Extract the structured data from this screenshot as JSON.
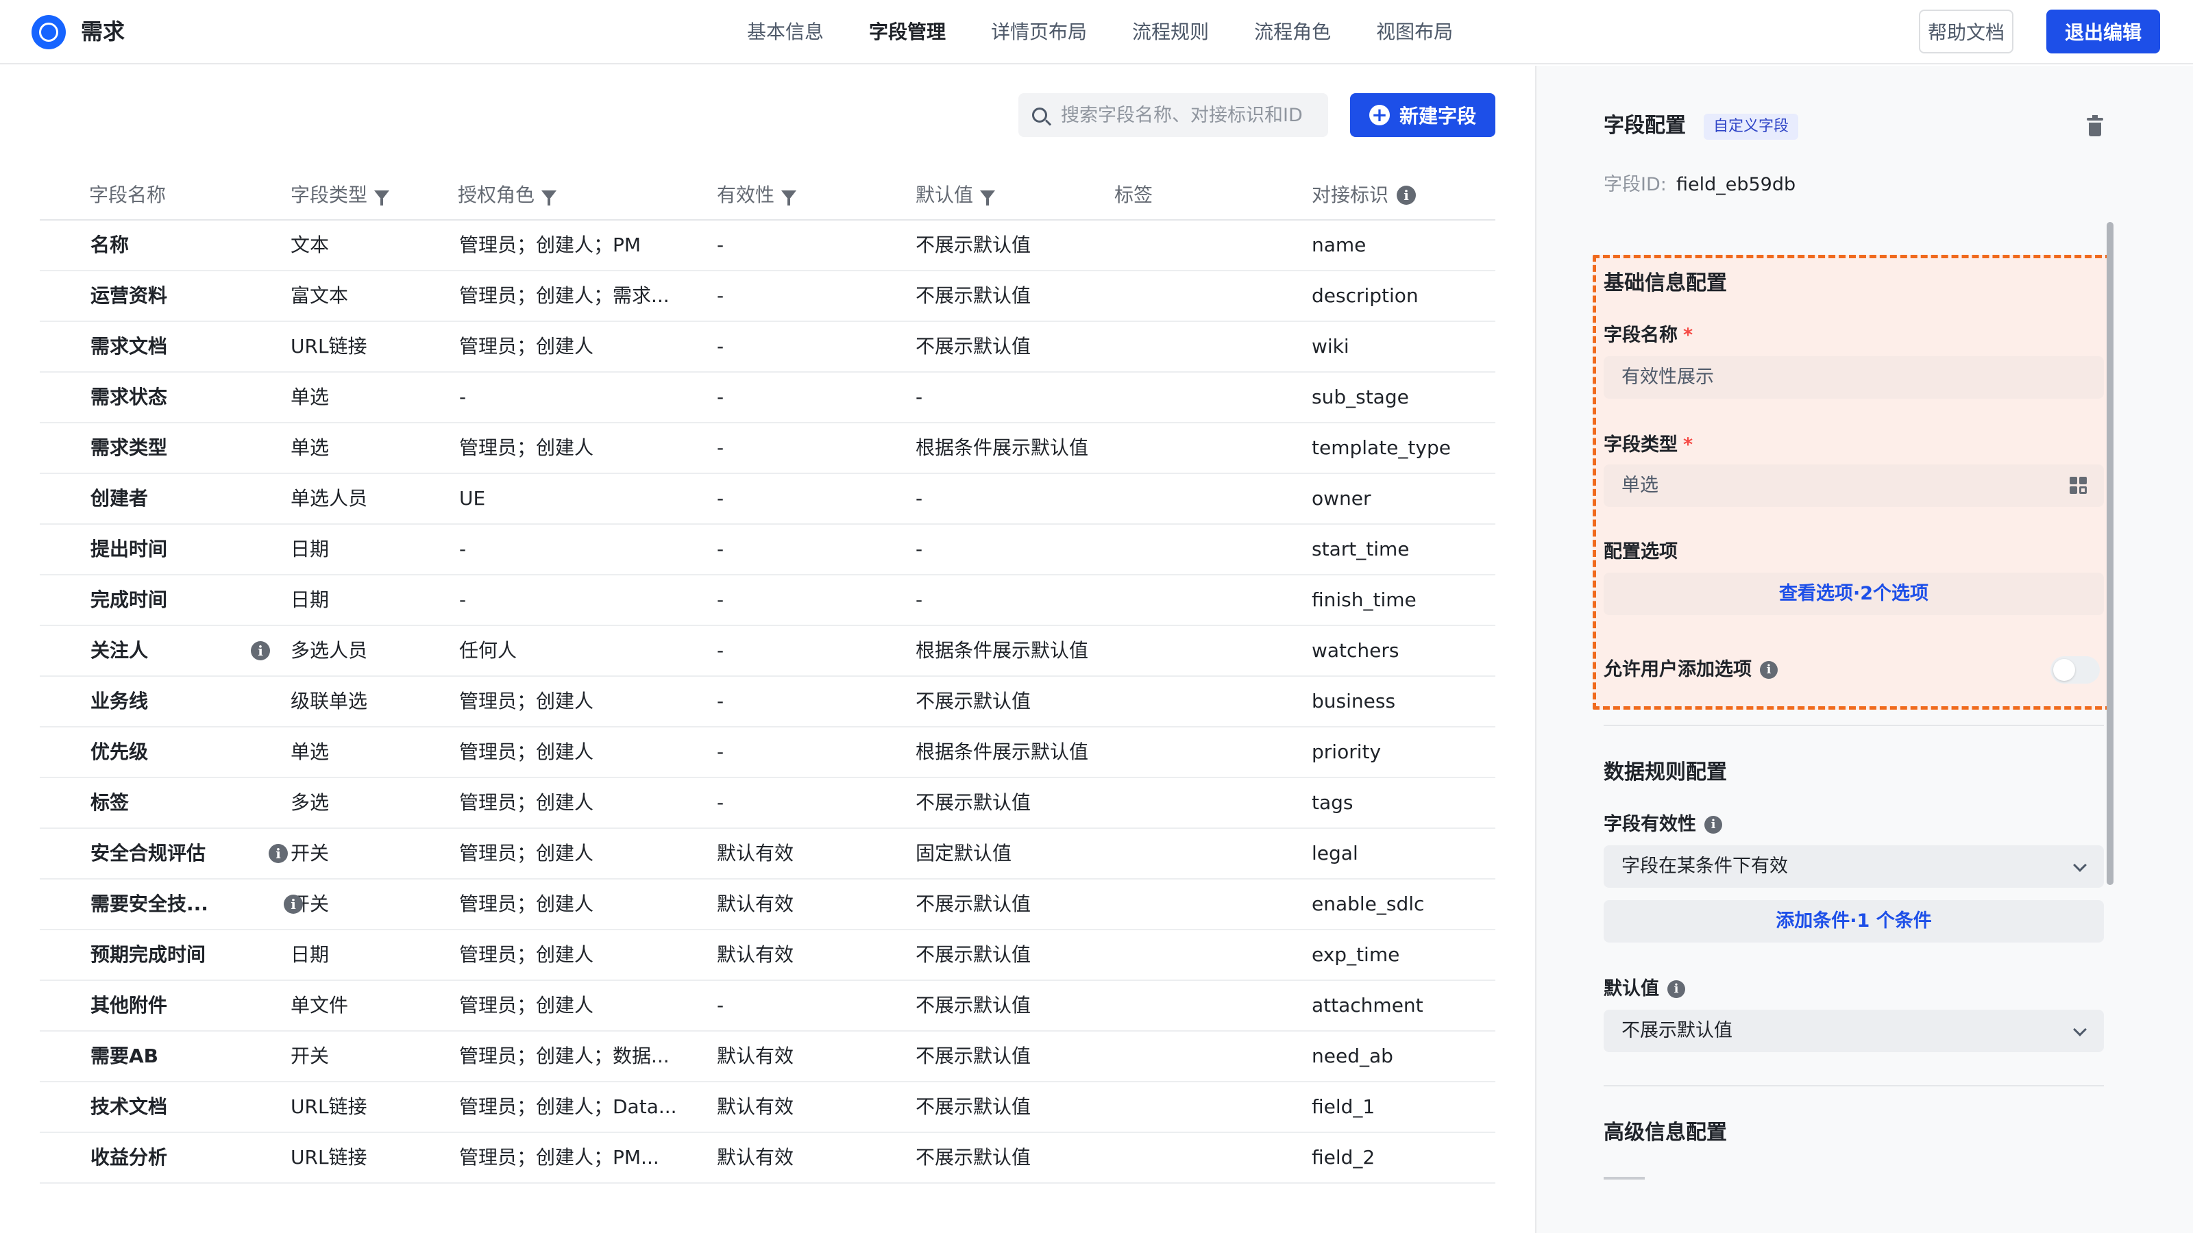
{
  "app": {
    "title": "需求"
  },
  "nav": [
    {
      "label": "基本信息",
      "active": false
    },
    {
      "label": "字段管理",
      "active": true
    },
    {
      "label": "详情页布局",
      "active": false
    },
    {
      "label": "流程规则",
      "active": false
    },
    {
      "label": "流程角色",
      "active": false
    },
    {
      "label": "视图布局",
      "active": false
    }
  ],
  "header_actions": {
    "help": "帮助文档",
    "exit": "退出编辑"
  },
  "toolbar": {
    "search_placeholder": "搜索字段名称、对接标识和ID",
    "new_field": "新建字段"
  },
  "table": {
    "columns": [
      "字段名称",
      "字段类型",
      "授权角色",
      "有效性",
      "默认值",
      "标签",
      "对接标识"
    ],
    "rows": [
      {
        "name": "名称",
        "type": "文本",
        "roles": "管理员；创建人；PM",
        "validity": "-",
        "default": "不展示默认值",
        "tag": "",
        "key": "name",
        "info": false
      },
      {
        "name": "运营资料",
        "type": "富文本",
        "roles": "管理员；创建人；需求...",
        "validity": "-",
        "default": "不展示默认值",
        "tag": "",
        "key": "description",
        "info": false
      },
      {
        "name": "需求文档",
        "type": "URL链接",
        "roles": "管理员；创建人",
        "validity": "-",
        "default": "不展示默认值",
        "tag": "",
        "key": "wiki",
        "info": false
      },
      {
        "name": "需求状态",
        "type": "单选",
        "roles": "-",
        "validity": "-",
        "default": "-",
        "tag": "",
        "key": "sub_stage",
        "info": false
      },
      {
        "name": "需求类型",
        "type": "单选",
        "roles": "管理员；创建人",
        "validity": "-",
        "default": "根据条件展示默认值",
        "tag": "",
        "key": "template_type",
        "info": false
      },
      {
        "name": "创建者",
        "type": "单选人员",
        "roles": "UE",
        "validity": "-",
        "default": "-",
        "tag": "",
        "key": "owner",
        "info": false
      },
      {
        "name": "提出时间",
        "type": "日期",
        "roles": "-",
        "validity": "-",
        "default": "-",
        "tag": "",
        "key": "start_time",
        "info": false
      },
      {
        "name": "完成时间",
        "type": "日期",
        "roles": "-",
        "validity": "-",
        "default": "-",
        "tag": "",
        "key": "finish_time",
        "info": false
      },
      {
        "name": "关注人",
        "type": "多选人员",
        "roles": "任何人",
        "validity": "-",
        "default": "根据条件展示默认值",
        "tag": "",
        "key": "watchers",
        "info": true
      },
      {
        "name": "业务线",
        "type": "级联单选",
        "roles": "管理员；创建人",
        "validity": "-",
        "default": "不展示默认值",
        "tag": "",
        "key": "business",
        "info": false
      },
      {
        "name": "优先级",
        "type": "单选",
        "roles": "管理员；创建人",
        "validity": "-",
        "default": "根据条件展示默认值",
        "tag": "",
        "key": "priority",
        "info": false
      },
      {
        "name": "标签",
        "type": "多选",
        "roles": "管理员；创建人",
        "validity": "-",
        "default": "不展示默认值",
        "tag": "",
        "key": "tags",
        "info": false
      },
      {
        "name": "安全合规评估",
        "type": "开关",
        "roles": "管理员；创建人",
        "validity": "默认有效",
        "default": "固定默认值",
        "tag": "",
        "key": "legal",
        "info": true
      },
      {
        "name": "需要安全技...",
        "type": "开关",
        "roles": "管理员；创建人",
        "validity": "默认有效",
        "default": "不展示默认值",
        "tag": "",
        "key": "enable_sdlc",
        "info": true
      },
      {
        "name": "预期完成时间",
        "type": "日期",
        "roles": "管理员；创建人",
        "validity": "默认有效",
        "default": "不展示默认值",
        "tag": "",
        "key": "exp_time",
        "info": false
      },
      {
        "name": "其他附件",
        "type": "单文件",
        "roles": "管理员；创建人",
        "validity": "-",
        "default": "不展示默认值",
        "tag": "",
        "key": "attachment",
        "info": false
      },
      {
        "name": "需要AB",
        "type": "开关",
        "roles": "管理员；创建人；数据...",
        "validity": "默认有效",
        "default": "不展示默认值",
        "tag": "",
        "key": "need_ab",
        "info": false
      },
      {
        "name": "技术文档",
        "type": "URL链接",
        "roles": "管理员；创建人；Data...",
        "validity": "默认有效",
        "default": "不展示默认值",
        "tag": "",
        "key": "field_1",
        "info": false
      },
      {
        "name": "收益分析",
        "type": "URL链接",
        "roles": "管理员；创建人；PM...",
        "validity": "默认有效",
        "default": "不展示默认值",
        "tag": "",
        "key": "field_2",
        "info": false
      }
    ]
  },
  "panel": {
    "title": "字段配置",
    "badge": "自定义字段",
    "field_id_label": "字段ID:",
    "field_id_value": "field_eb59db",
    "basic": {
      "title": "基础信息配置",
      "name_label": "字段名称",
      "name_value": "有效性展示",
      "type_label": "字段类型",
      "type_value": "单选",
      "options_label": "配置选项",
      "options_link": "查看选项·2个选项",
      "allow_add_label": "允许用户添加选项",
      "allow_add_on": false,
      "required_mark": "*"
    },
    "data_rules": {
      "title": "数据规则配置",
      "validity_label": "字段有效性",
      "validity_value": "字段在某条件下有效",
      "add_condition": "添加条件·1 个条件",
      "default_label": "默认值",
      "default_value": "不展示默认值"
    },
    "advanced": {
      "title": "高级信息配置"
    }
  },
  "colors": {
    "accent": "#1d4fe8",
    "highlight_border": "#f06a1d",
    "required": "#f54a45"
  }
}
